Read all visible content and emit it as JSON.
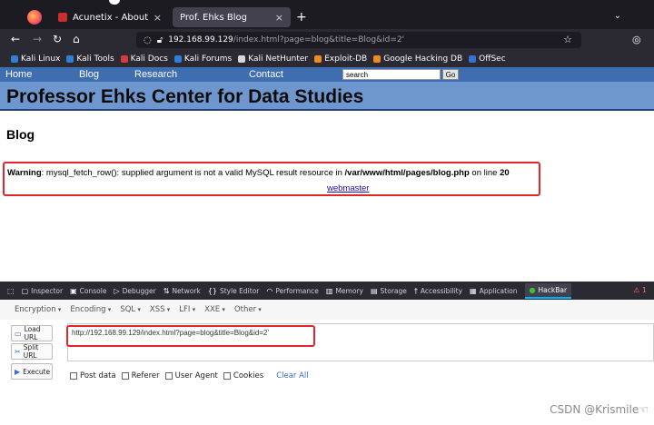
{
  "browser": {
    "tabs": [
      {
        "title": "Acunetix - About"
      },
      {
        "title": "Prof. Ehks Blog"
      }
    ],
    "new_tab": "+",
    "tab_close": "×",
    "tab_menu": "⌄",
    "url": {
      "host": "192.168.99.129",
      "rest": "/index.html?page=blog&title=Blog&id=2'"
    },
    "bookmarks": [
      {
        "label": "Kali Linux",
        "color": "#2f7fd8"
      },
      {
        "label": "Kali Tools",
        "color": "#2f7fd8"
      },
      {
        "label": "Kali Docs",
        "color": "#d83b3b"
      },
      {
        "label": "Kali Forums",
        "color": "#2f7fd8"
      },
      {
        "label": "Kali NetHunter",
        "color": "#d8d8d8"
      },
      {
        "label": "Exploit-DB",
        "color": "#f08a24"
      },
      {
        "label": "Google Hacking DB",
        "color": "#f08a24"
      },
      {
        "label": "OffSec",
        "color": "#3b6fd8"
      }
    ]
  },
  "site": {
    "nav": [
      "Home",
      "Blog",
      "Research",
      "Contact"
    ],
    "search_value": "search",
    "go_label": "Go",
    "header": "Professor Ehks Center for Data Studies",
    "page_title": "Blog",
    "warning": {
      "label": "Warning",
      "text": ": mysql_fetch_row(): supplied argument is not a valid MySQL result resource in ",
      "path": "/var/www/html/pages/blog.php",
      "online": " on line ",
      "line": "20"
    },
    "link": "webmaster"
  },
  "devtools": {
    "tabs": [
      "Inspector",
      "Console",
      "Debugger",
      "Network",
      "Style Editor",
      "Performance",
      "Memory",
      "Storage",
      "Accessibility",
      "Application",
      "HackBar"
    ],
    "error_count": "1"
  },
  "hackbar": {
    "menu": [
      "Encryption",
      "Encoding",
      "SQL",
      "XSS",
      "LFI",
      "XXE",
      "Other"
    ],
    "buttons": [
      "Load URL",
      "Split URL",
      "Execute"
    ],
    "url_value": "http://192.168.99.129/index.html?page=blog&title=Blog&id=2'",
    "options": [
      "Post data",
      "Referer",
      "User Agent",
      "Cookies"
    ],
    "clear_all": "Clear All"
  },
  "watermark": "CSDN @Krismile☜"
}
